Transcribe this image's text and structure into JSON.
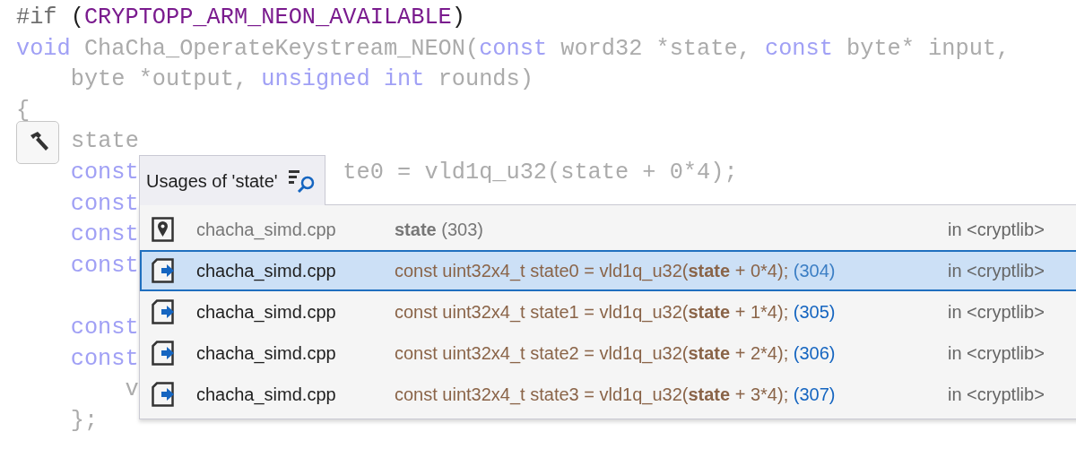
{
  "code_lines": [
    {
      "segments": [
        {
          "kind": "directive",
          "text": "#if"
        },
        {
          "kind": "punct",
          "text": " ("
        },
        {
          "kind": "macro",
          "text": "CRYPTOPP_ARM_NEON_AVAILABLE"
        },
        {
          "kind": "punct",
          "text": ")"
        }
      ]
    },
    {
      "segments": [
        {
          "kind": "keyword",
          "text": "void"
        },
        {
          "kind": "plain",
          "text": " ChaCha_OperateKeystream_NEON("
        },
        {
          "kind": "keyword",
          "text": "const"
        },
        {
          "kind": "plain",
          "text": " word32 *state, "
        },
        {
          "kind": "keyword",
          "text": "const"
        },
        {
          "kind": "plain",
          "text": " byte* input,"
        }
      ]
    },
    {
      "segments": [
        {
          "kind": "plain",
          "text": "    byte *output, "
        },
        {
          "kind": "keyword",
          "text": "unsigned"
        },
        {
          "kind": "keyword",
          "text": " int"
        },
        {
          "kind": "plain",
          "text": " rounds)"
        }
      ]
    },
    {
      "segments": [
        {
          "kind": "plain",
          "text": "{"
        }
      ]
    },
    {
      "quick_action": true,
      "segments": [
        {
          "kind": "plain",
          "text": "state"
        }
      ]
    },
    {
      "segments": [
        {
          "kind": "keyword",
          "text": "    const"
        }
      ],
      "tail": "te0 = vld1q_u32(state + 0*4);"
    },
    {
      "segments": [
        {
          "kind": "keyword",
          "text": "    const"
        }
      ]
    },
    {
      "segments": [
        {
          "kind": "keyword",
          "text": "    const"
        }
      ]
    },
    {
      "segments": [
        {
          "kind": "keyword",
          "text": "    const"
        }
      ]
    },
    {
      "gap_before": true,
      "segments": [
        {
          "kind": "keyword",
          "text": "    const"
        }
      ]
    },
    {
      "segments": [
        {
          "kind": "keyword",
          "text": "    const"
        }
      ]
    },
    {
      "segments": [
        {
          "kind": "plain",
          "text": "        v"
        }
      ]
    },
    {
      "segments": [
        {
          "kind": "plain",
          "text": "    };"
        }
      ]
    }
  ],
  "usages_popup": {
    "title": "Usages of 'state'",
    "rows": [
      {
        "kind": "definition",
        "file": "chacha_simd.cpp",
        "text": "**state**",
        "line": "(303)",
        "scope": "in <cryptlib>",
        "selected": false
      },
      {
        "kind": "usage",
        "file": "chacha_simd.cpp",
        "text": "const uint32x4_t state0 = vld1q_u32(**state** + 0*4);",
        "line": "(304)",
        "scope": "in <cryptlib>",
        "selected": true
      },
      {
        "kind": "usage",
        "file": "chacha_simd.cpp",
        "text": "const uint32x4_t state1 = vld1q_u32(**state** + 1*4);",
        "line": "(305)",
        "scope": "in <cryptlib>",
        "selected": false
      },
      {
        "kind": "usage",
        "file": "chacha_simd.cpp",
        "text": "const uint32x4_t state2 = vld1q_u32(**state** + 2*4);",
        "line": "(306)",
        "scope": "in <cryptlib>",
        "selected": false
      },
      {
        "kind": "usage",
        "file": "chacha_simd.cpp",
        "text": "const uint32x4_t state3 = vld1q_u32(**state** + 3*4);",
        "line": "(307)",
        "scope": "in <cryptlib>",
        "selected": false
      }
    ]
  }
}
